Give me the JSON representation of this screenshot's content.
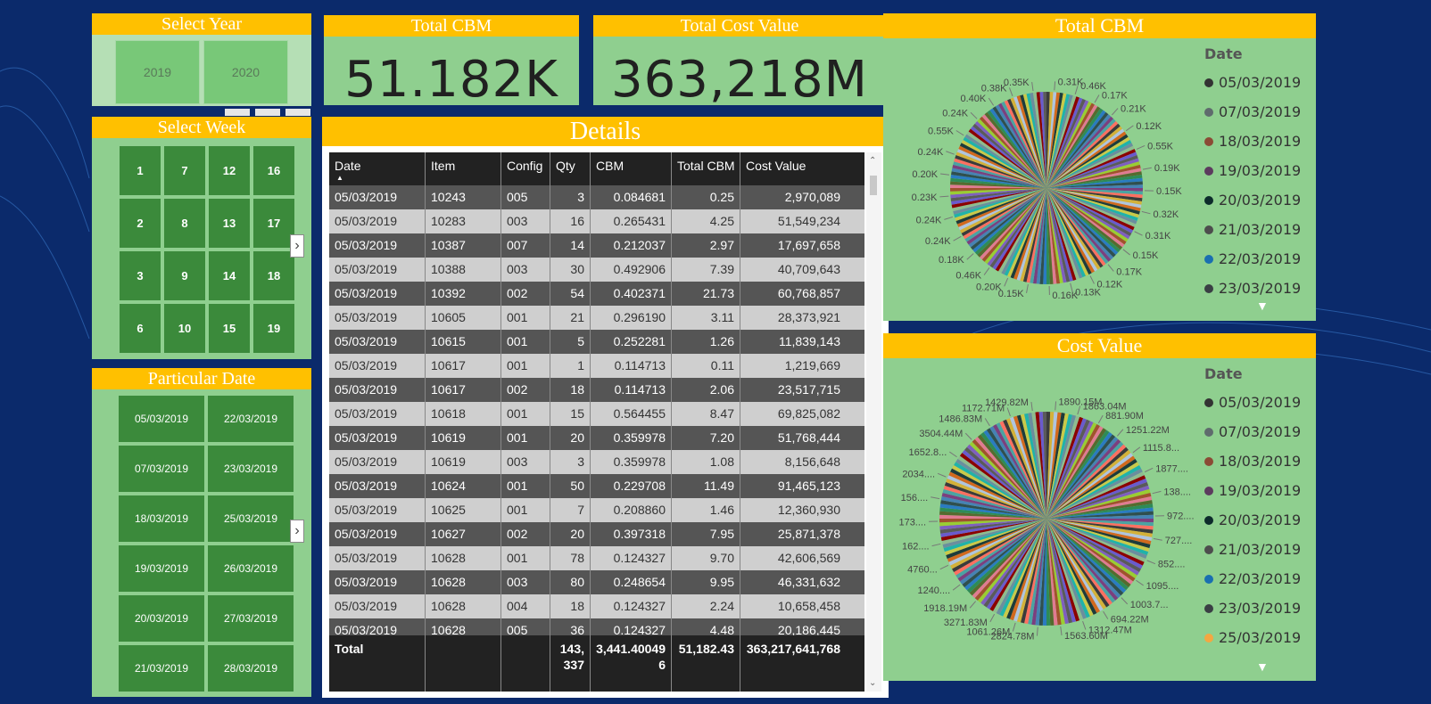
{
  "year_slicer": {
    "title": "Select Year",
    "years": [
      "2019",
      "2020"
    ]
  },
  "week_slicer": {
    "title": "Select Week",
    "weeks": [
      "1",
      "7",
      "12",
      "16",
      "2",
      "8",
      "13",
      "17",
      "3",
      "9",
      "14",
      "18",
      "6",
      "10",
      "15",
      "19"
    ]
  },
  "date_slicer": {
    "title": "Particular Date",
    "dates": [
      "05/03/2019",
      "22/03/2019",
      "07/03/2019",
      "23/03/2019",
      "18/03/2019",
      "25/03/2019",
      "19/03/2019",
      "26/03/2019",
      "20/03/2019",
      "27/03/2019",
      "21/03/2019",
      "28/03/2019"
    ]
  },
  "kpi": {
    "cbm_title": "Total CBM",
    "cbm_value": "51.182K",
    "cost_title": "Total Cost Value",
    "cost_value": "363,218M"
  },
  "details": {
    "title": "Details",
    "columns": [
      "Date",
      "Item",
      "Config",
      "Qty",
      "CBM",
      "Total CBM",
      "Cost Value"
    ],
    "rows": [
      [
        "05/03/2019",
        "10243",
        "005",
        "3",
        "0.084681",
        "0.25",
        "2,970,089"
      ],
      [
        "05/03/2019",
        "10283",
        "003",
        "16",
        "0.265431",
        "4.25",
        "51,549,234"
      ],
      [
        "05/03/2019",
        "10387",
        "007",
        "14",
        "0.212037",
        "2.97",
        "17,697,658"
      ],
      [
        "05/03/2019",
        "10388",
        "003",
        "30",
        "0.492906",
        "7.39",
        "40,709,643"
      ],
      [
        "05/03/2019",
        "10392",
        "002",
        "54",
        "0.402371",
        "21.73",
        "60,768,857"
      ],
      [
        "05/03/2019",
        "10605",
        "001",
        "21",
        "0.296190",
        "3.11",
        "28,373,921"
      ],
      [
        "05/03/2019",
        "10615",
        "001",
        "5",
        "0.252281",
        "1.26",
        "11,839,143"
      ],
      [
        "05/03/2019",
        "10617",
        "001",
        "1",
        "0.114713",
        "0.11",
        "1,219,669"
      ],
      [
        "05/03/2019",
        "10617",
        "002",
        "18",
        "0.114713",
        "2.06",
        "23,517,715"
      ],
      [
        "05/03/2019",
        "10618",
        "001",
        "15",
        "0.564455",
        "8.47",
        "69,825,082"
      ],
      [
        "05/03/2019",
        "10619",
        "001",
        "20",
        "0.359978",
        "7.20",
        "51,768,444"
      ],
      [
        "05/03/2019",
        "10619",
        "003",
        "3",
        "0.359978",
        "1.08",
        "8,156,648"
      ],
      [
        "05/03/2019",
        "10624",
        "001",
        "50",
        "0.229708",
        "11.49",
        "91,465,123"
      ],
      [
        "05/03/2019",
        "10625",
        "001",
        "7",
        "0.208860",
        "1.46",
        "12,360,930"
      ],
      [
        "05/03/2019",
        "10627",
        "002",
        "20",
        "0.397318",
        "7.95",
        "25,871,378"
      ],
      [
        "05/03/2019",
        "10628",
        "001",
        "78",
        "0.124327",
        "9.70",
        "42,606,569"
      ],
      [
        "05/03/2019",
        "10628",
        "003",
        "80",
        "0.248654",
        "9.95",
        "46,331,632"
      ],
      [
        "05/03/2019",
        "10628",
        "004",
        "18",
        "0.124327",
        "2.24",
        "10,658,458"
      ],
      [
        "05/03/2019",
        "10628",
        "005",
        "36",
        "0.124327",
        "4.48",
        "20,186,445"
      ]
    ],
    "total": {
      "label": "Total",
      "qty": "143,337",
      "cbm": "3,441.400496",
      "total_cbm": "51,182.43",
      "cost": "363,217,641,768"
    }
  },
  "pie_cbm": {
    "title": "Total CBM",
    "legend_title": "Date",
    "legend": [
      {
        "label": "05/03/2019",
        "color": "#333333"
      },
      {
        "label": "07/03/2019",
        "color": "#5f6b6d"
      },
      {
        "label": "18/03/2019",
        "color": "#8b4a35"
      },
      {
        "label": "19/03/2019",
        "color": "#5c3b5e"
      },
      {
        "label": "20/03/2019",
        "color": "#0d2b2b"
      },
      {
        "label": "21/03/2019",
        "color": "#4d4d4d"
      },
      {
        "label": "22/03/2019",
        "color": "#1a6fb0"
      },
      {
        "label": "23/03/2019",
        "color": "#3a3f44"
      }
    ],
    "labels": [
      "0.31K",
      "0.46K",
      "0.17K",
      "0.21K",
      "0.12K",
      "0.55K",
      "0.19K",
      "0.15K",
      "0.32K",
      "0.31K",
      "0.15K",
      "0.17K",
      "0.12K",
      "0.13K",
      "0.16K",
      "0.15K",
      "0.20K",
      "0.46K",
      "0.18K",
      "0.24K",
      "0.24K",
      "0.23K",
      "0.20K",
      "0.24K",
      "0.55K",
      "0.24K",
      "0.40K",
      "0.38K",
      "0.35K"
    ]
  },
  "pie_cost": {
    "title": "Cost Value",
    "legend_title": "Date",
    "legend": [
      {
        "label": "05/03/2019",
        "color": "#333333"
      },
      {
        "label": "07/03/2019",
        "color": "#5f6b6d"
      },
      {
        "label": "18/03/2019",
        "color": "#8b4a35"
      },
      {
        "label": "19/03/2019",
        "color": "#5c3b5e"
      },
      {
        "label": "20/03/2019",
        "color": "#0d2b2b"
      },
      {
        "label": "21/03/2019",
        "color": "#4d4d4d"
      },
      {
        "label": "22/03/2019",
        "color": "#1a6fb0"
      },
      {
        "label": "23/03/2019",
        "color": "#3a3f44"
      },
      {
        "label": "25/03/2019",
        "color": "#f4a742"
      }
    ],
    "labels": [
      "1890.15M",
      "1863.04M",
      "881.90M",
      "1251.22M",
      "1115.8...",
      "1877....",
      "138....",
      "972....",
      "727....",
      "852....",
      "1095....",
      "1003.7...",
      "694.22M",
      "1312.47M",
      "1563.60M",
      "2824.78M",
      "1061.26M",
      "3271.83M",
      "1918.19M",
      "1240....",
      "4760...",
      "162....",
      "173....",
      "156....",
      "2034....",
      "1652.8...",
      "3504.44M",
      "1486.83M",
      "1172.71M",
      "1429.82M"
    ]
  }
}
